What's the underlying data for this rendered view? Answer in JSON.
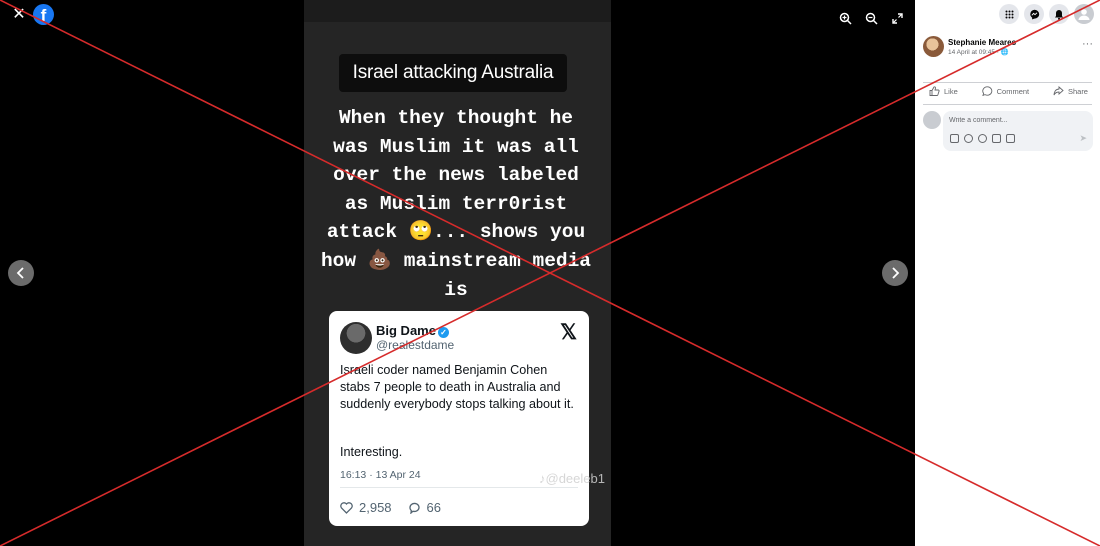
{
  "viewer": {
    "close_icon": "close-icon",
    "logo_letter": "f",
    "tools": [
      "zoom-in-icon",
      "zoom-out-icon",
      "fullscreen-icon"
    ]
  },
  "photo": {
    "caption_label": "Israel attacking Australia",
    "meme_lines": [
      "When they thought he",
      "was Muslim it was all",
      "over the news labeled",
      "as Muslim terr0rist",
      "attack 🙄... shows you",
      "how 💩 mainstream media",
      "is"
    ],
    "tweet": {
      "name": "Big Dame",
      "verified_mark": "✓",
      "handle": "@realestdame",
      "x_logo": "𝕏",
      "body": "Israeli coder named Benjamin Cohen stabs 7 people to death in Australia and suddenly everybody stops talking about it.",
      "interesting": "Interesting.",
      "time": "16:13 · 13 Apr 24",
      "likes": "2,958",
      "replies": "66"
    },
    "watermark": "♪@deeleb1"
  },
  "sidebar": {
    "header_icons": [
      "menu-grid-icon",
      "messenger-icon",
      "notifications-icon",
      "profile-icon"
    ],
    "post": {
      "author": "Stephanie Meares",
      "date": "14 April at 09:45 · 🌐",
      "more": "···"
    },
    "actions": {
      "like": "Like",
      "comment": "Comment",
      "share": "Share"
    },
    "comment_placeholder": "Write a comment...",
    "send": "➤"
  },
  "colors": {
    "facebook_blue": "#1877f2",
    "cross_red": "#d62b2b"
  }
}
